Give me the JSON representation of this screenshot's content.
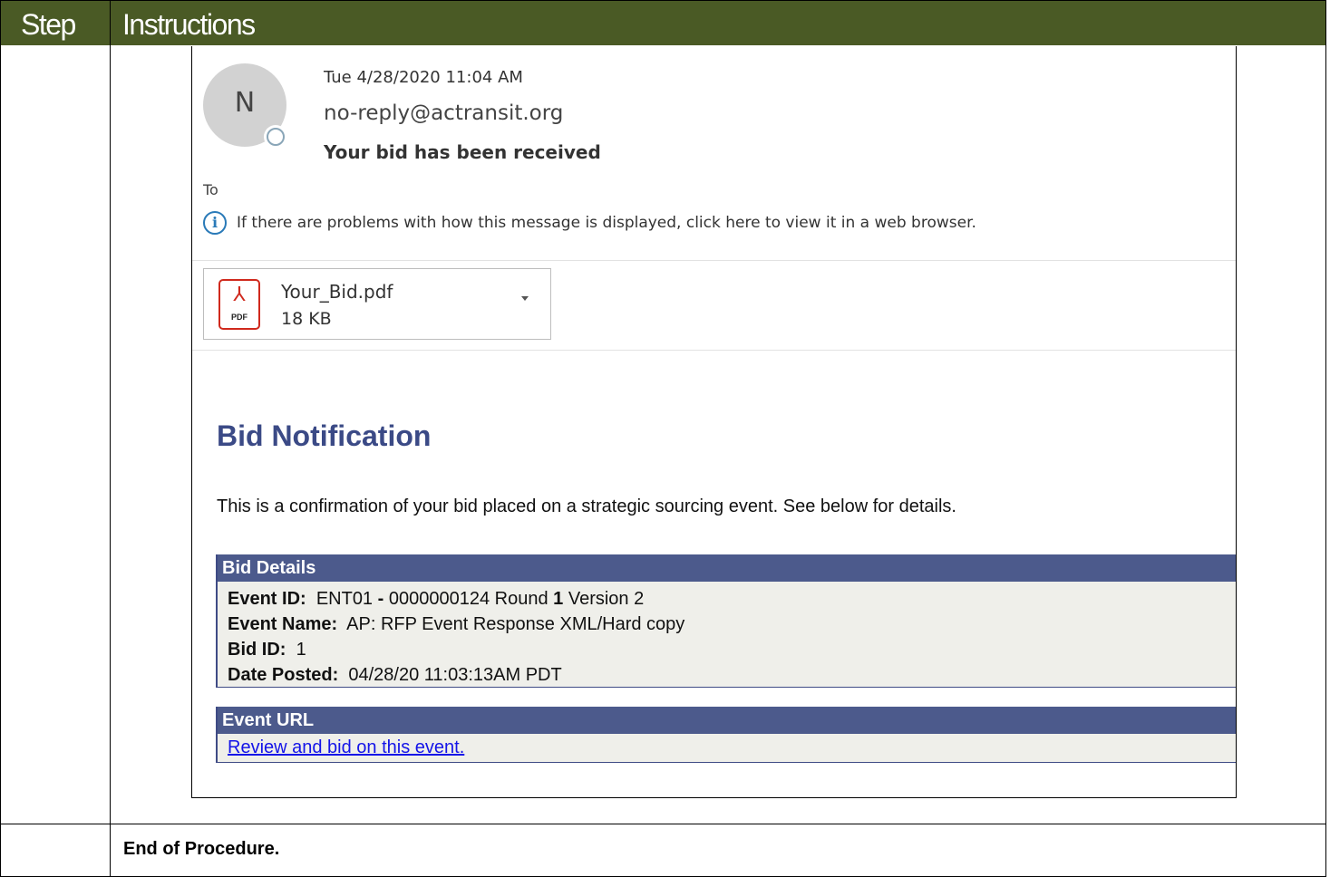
{
  "table": {
    "header": {
      "step": "Step",
      "instructions": "Instructions"
    },
    "end_text": "End of Procedure."
  },
  "colors": {
    "header_bg": "#4a5a25",
    "section_header": "#4c5a8c",
    "title_color": "#3b4a86",
    "link": "#1414e8"
  },
  "email": {
    "avatar_letter": "N",
    "date": "Tue 4/28/2020 11:04 AM",
    "from": "no-reply@actransit.org",
    "subject": "Your bid has been received",
    "to_label": "To",
    "info_text": "If there are problems with how this message is displayed, click here to view it in a web browser.",
    "attachment": {
      "icon": "pdf-icon",
      "icon_tag": "PDF",
      "name": "Your_Bid.pdf",
      "size": "18 KB"
    },
    "body": {
      "title": "Bid Notification",
      "confirmation": "This is a confirmation of your bid placed on a strategic sourcing event. See below for details.",
      "details": {
        "header": "Bid Details",
        "event_id_label": "Event ID:",
        "event_id_value": "ENT01",
        "event_id_sep": "-",
        "event_id_rest": "0000000124 Round",
        "round_num": "1",
        "version_text": "Version 2",
        "event_name_label": "Event Name:",
        "event_name_value": "AP: RFP Event Response XML/Hard copy",
        "bid_id_label": "Bid ID:",
        "bid_id_value": "1",
        "date_posted_label": "Date Posted:",
        "date_posted_value": "04/28/20 11:03:13AM PDT"
      },
      "event_url": {
        "header": "Event URL",
        "link_text": "Review and bid on this event."
      }
    }
  }
}
